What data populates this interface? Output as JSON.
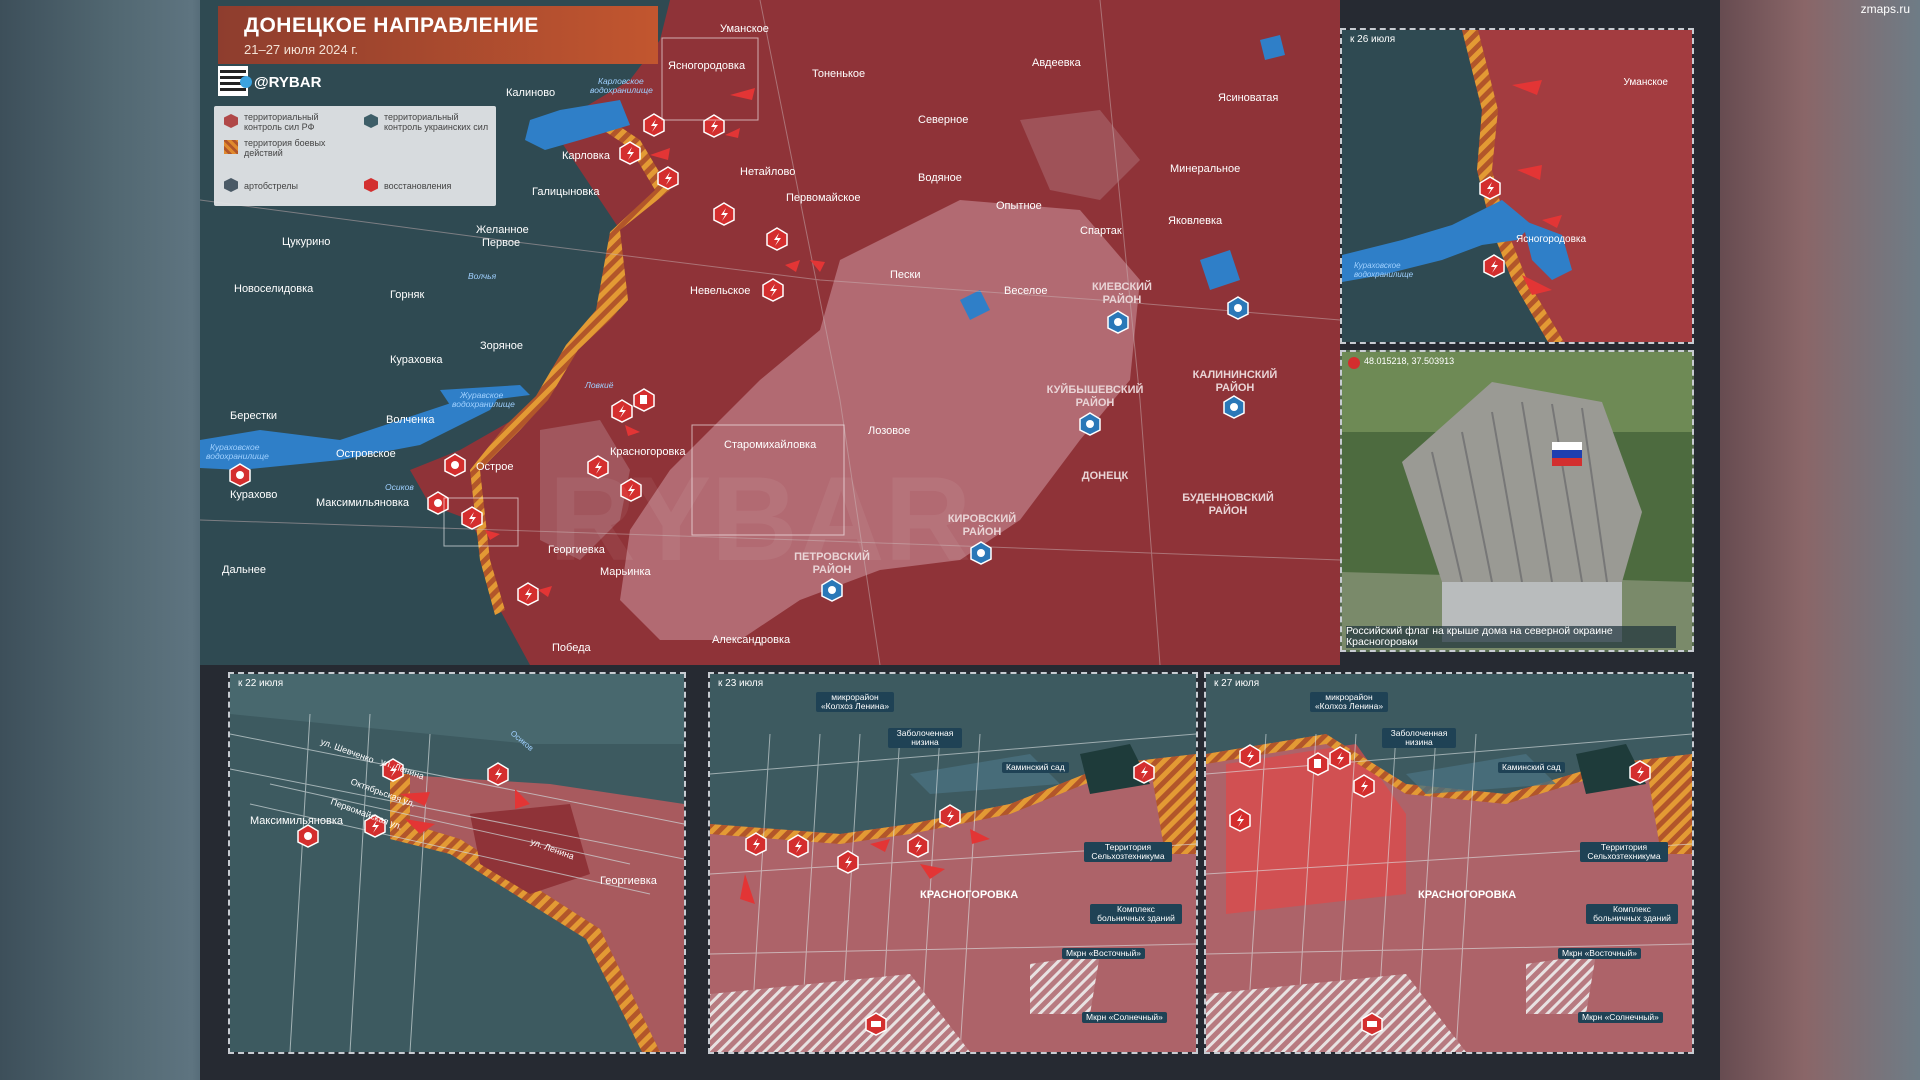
{
  "watermark": "zmaps.ru",
  "header": {
    "title": "ДОНЕЦКОЕ НАПРАВЛЕНИЕ",
    "subtitle": "21–27 июля 2024 г.",
    "channel": "@RYBAR"
  },
  "legend": {
    "items": [
      {
        "label": "территориальный контроль сил РФ",
        "color": "#b04848"
      },
      {
        "label": "территориальный контроль украинских сил",
        "color": "#3e5e68"
      },
      {
        "label": "территория боевых действий",
        "color": "#e08a2e"
      },
      {
        "label": "артобстрелы",
        "color": "#4a5a66"
      },
      {
        "label": "восстановления",
        "color": "#d33030"
      }
    ]
  },
  "colors": {
    "ru_control": "#8f3338",
    "ua_control": "#2f4a52",
    "city_ru": "#b8747c",
    "combat_zone": "#e0902e",
    "attack": "#e13232",
    "river": "#2f7fc8"
  },
  "main_map": {
    "towns": [
      "Уманское",
      "Ясногородовка",
      "Авдеевка",
      "Тоненькое",
      "Калиново",
      "Карловское водохранилище",
      "Северное",
      "Ясиноватая",
      "Карловка",
      "Нетайлово",
      "Водяное",
      "Минеральное",
      "Галицыновка",
      "Первомайское",
      "Опытное",
      "Спартак",
      "Яковлевка",
      "Цукурино",
      "Желанное Первое",
      "Пески",
      "Невельское",
      "Веселое",
      "Новоселидовка",
      "Горняк",
      "Волчья",
      "Зоряное",
      "Кураховка",
      "Береcтки",
      "Волченка",
      "Кураховское водохранилище",
      "Островское",
      "Острое",
      "Лозовое",
      "Красногоровка",
      "Старомихайловка",
      "Курахово",
      "Максимильяновка",
      "Осиков",
      "Георгиевка",
      "Марьинка",
      "Дальнее",
      "Победа",
      "Александровка"
    ],
    "districts": [
      "КИЕВСКИЙ РАЙОН",
      "КУЙБЫШЕВСКИЙ РАЙОН",
      "КАЛИНИНСКИЙ РАЙОН",
      "ДОНЕЦК",
      "БУДЕННОВСКИЙ РАЙОН",
      "КИРОВСКИЙ РАЙОН",
      "ПЕТРОВСКИЙ РАЙОН"
    ]
  },
  "inset_top": {
    "date": "к 26 июля",
    "labels": [
      "Уманское",
      "Ясногородовка",
      "Кураховское водохранилище"
    ]
  },
  "photo": {
    "coords": "48.015218, 37.503913",
    "caption": "Российский флаг на крыше дома на северной окраине Красногоровки"
  },
  "inset_22": {
    "date": "к 22 июля",
    "labels": [
      "ул. Шевченко",
      "ул. Ленина",
      "Октябрьская ул.",
      "Первомайская ул.",
      "Максимильяновка",
      "Осиков",
      "ул. Ленина",
      "Георгиевка"
    ]
  },
  "inset_23": {
    "date": "к 23 июля",
    "tags": [
      "микрорайон «Колхоз Ленина»",
      "Заболоченная низина",
      "Каминский сад",
      "Территория Сельхозтехникума",
      "Комплекс больничных зданий",
      "Мкрн «Восточный»",
      "Мкрн «Солнечный»"
    ],
    "town": "КРАСНОГОРОВКА"
  },
  "inset_27": {
    "date": "к 27 июля",
    "tags": [
      "микрорайон «Колхоз Ленина»",
      "Заболоченная низина",
      "Каминский сад",
      "Территория Сельхозтехникума",
      "Комплекс больничных зданий",
      "Мкрн «Восточный»",
      "Мкрн «Солнечный»"
    ],
    "town": "КРАСНОГОРОВКА"
  }
}
